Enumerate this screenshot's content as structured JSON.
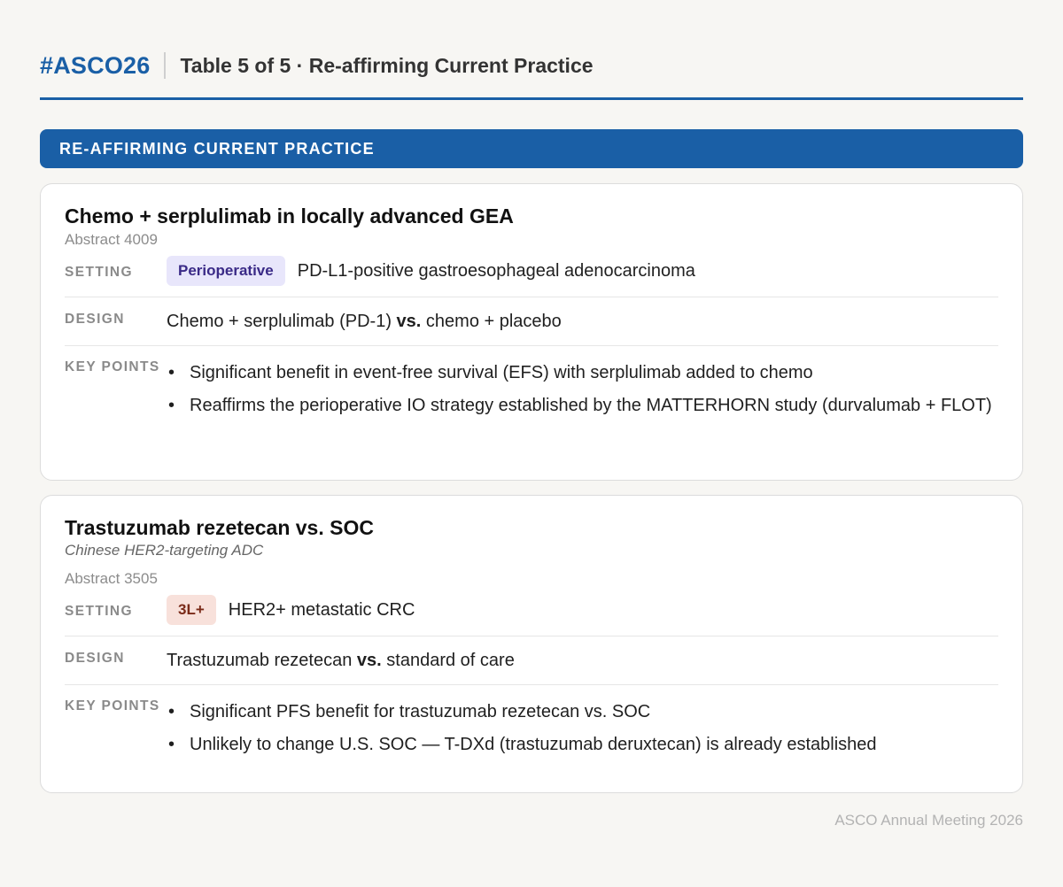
{
  "header": {
    "brand": "#ASCO26",
    "title": "Table 5 of 5 · Re-affirming Current Practice"
  },
  "section": {
    "label": "RE-AFFIRMING CURRENT PRACTICE"
  },
  "labels": {
    "setting": "SETTING",
    "design": "DESIGN",
    "key_points": "KEY POINTS",
    "vs": "vs."
  },
  "cards": [
    {
      "title": "Chemo + serplulimab in locally advanced GEA",
      "abstract": "Abstract 4009",
      "setting_badge": "Perioperative",
      "setting_text": "PD-L1-positive gastroesophageal adenocarcinoma",
      "design_a": "Chemo + serplulimab (PD-1)",
      "design_b": "chemo + placebo",
      "key_points": [
        "Significant benefit in event-free survival (EFS) with serplulimab added to chemo",
        "Reaffirms the perioperative IO strategy established by the MATTERHORN study (durvalumab + FLOT)"
      ]
    },
    {
      "title": "Trastuzumab rezetecan vs. SOC",
      "subtitle": "Chinese HER2-targeting ADC",
      "abstract": "Abstract 3505",
      "setting_badge": "3L+",
      "setting_text": "HER2+ metastatic CRC",
      "design_a": "Trastuzumab rezetecan",
      "design_b": "standard of care",
      "key_points": [
        "Significant PFS benefit for trastuzumab rezetecan vs. SOC",
        "Unlikely to change U.S. SOC — T-DXd (trastuzumab deruxtecan) is already established"
      ]
    }
  ],
  "footer": {
    "text": "ASCO Annual Meeting 2026"
  },
  "colors": {
    "accent": "#1a5fa6",
    "badge_perioperative": "#e8e6fb",
    "badge_3l": "#f8e1db"
  }
}
